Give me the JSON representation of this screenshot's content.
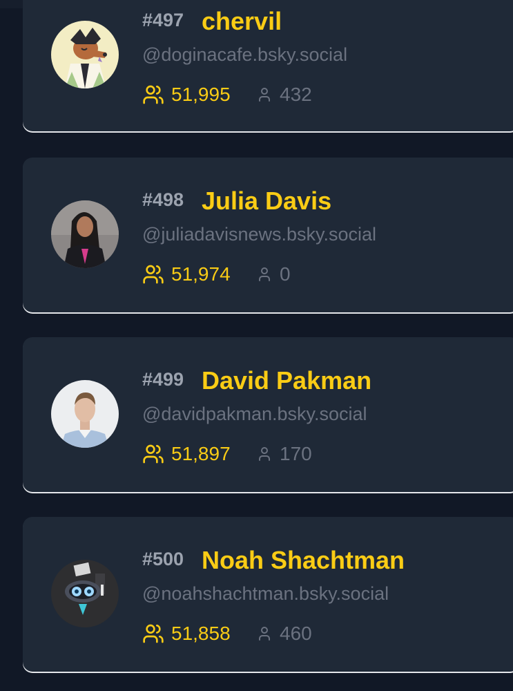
{
  "accounts": [
    {
      "rank": "#497",
      "name": "chervil",
      "handle": "@doginacafe.bsky.social",
      "followers": "51,995",
      "following": "432"
    },
    {
      "rank": "#498",
      "name": "Julia Davis",
      "handle": "@juliadavisnews.bsky.social",
      "followers": "51,974",
      "following": "0"
    },
    {
      "rank": "#499",
      "name": "David Pakman",
      "handle": "@davidpakman.bsky.social",
      "followers": "51,897",
      "following": "170"
    },
    {
      "rank": "#500",
      "name": "Noah Shachtman",
      "handle": "@noahshachtman.bsky.social",
      "followers": "51,858",
      "following": "460"
    }
  ],
  "icons": {
    "followers": "users-icon",
    "following": "user-icon"
  },
  "colors": {
    "background": "#111826",
    "card": "#1f2937",
    "accent": "#facc15",
    "muted": "#6b7280",
    "rank": "#9ca3af"
  }
}
